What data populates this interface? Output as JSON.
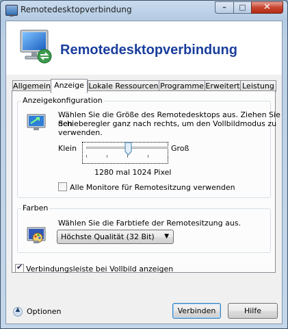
{
  "window": {
    "title": "Remotedesktopverbindung",
    "minimize": "–",
    "maximize": "□",
    "close": "✕"
  },
  "banner": {
    "title": "Remotedesktopverbindung"
  },
  "tabs": [
    {
      "label": "Allgemein"
    },
    {
      "label": "Anzeige"
    },
    {
      "label": "Lokale Ressourcen"
    },
    {
      "label": "Programme"
    },
    {
      "label": "Erweitert"
    },
    {
      "label": "Leistung"
    }
  ],
  "display_config": {
    "legend": "Anzeigekonfiguration",
    "description_line1": "Wählen Sie die Größe des Remotedesktops aus. Ziehen Sie den",
    "description_line2": "Schieberegler ganz nach rechts, um den Vollbildmodus zu",
    "description_line3": "verwenden.",
    "slider_min_label": "Klein",
    "slider_max_label": "Groß",
    "slider_value": 0.5,
    "resolution": "1280 mal 1024 Pixel",
    "all_monitors_label": "Alle Monitore für Remotesitzung verwenden",
    "all_monitors_checked": false
  },
  "colors": {
    "legend": "Farben",
    "description": "Wählen Sie die Farbtiefe der Remotesitzung aus.",
    "selected_depth": "Höchste Qualität (32 Bit)"
  },
  "connection_bar": {
    "label": "Verbindungsleiste bei Vollbild anzeigen",
    "checked": true
  },
  "footer": {
    "options_label": "Optionen",
    "connect_label": "Verbinden",
    "help_label": "Hilfe"
  },
  "accent_color": "#1a3e9c"
}
